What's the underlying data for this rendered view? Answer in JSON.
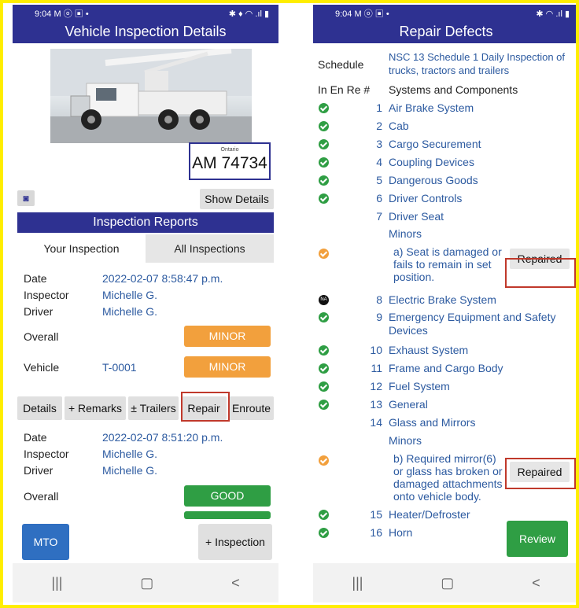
{
  "left": {
    "status_time": "9:04",
    "status_left_icons": "M ⓞ ▣ •",
    "status_right_icons": "✱ ♦ ◠ .ıl ▮",
    "title": "Vehicle Inspection Details",
    "plate_province": "Ontario",
    "plate_number": "AM 74734",
    "show_details": "Show Details",
    "section_title": "Inspection Reports",
    "tabs": [
      "Your Inspection",
      "All Inspections"
    ],
    "report1": {
      "date_label": "Date",
      "date": "2022-02-07 8:58:47 p.m.",
      "inspector_label": "Inspector",
      "inspector": "Michelle G.",
      "driver_label": "Driver",
      "driver": "Michelle G.",
      "overall_label": "Overall",
      "overall": "MINOR",
      "vehicle_label": "Vehicle",
      "vehicle": "T-0001",
      "vehicle_status": "MINOR"
    },
    "actions": [
      "Details",
      "+ Remarks",
      "± Trailers",
      "Repair",
      "Enroute"
    ],
    "report2": {
      "date_label": "Date",
      "date": "2022-02-07 8:51:20 p.m.",
      "inspector_label": "Inspector",
      "inspector": "Michelle G.",
      "driver_label": "Driver",
      "driver": "Michelle G.",
      "overall_label": "Overall",
      "overall": "GOOD"
    },
    "mto": "MTO",
    "add_inspection": "+ Inspection"
  },
  "right": {
    "status_time": "9:04",
    "status_left_icons": "M ⓞ ▣ •",
    "status_right_icons": "✱ ◠ .ıl ▮",
    "title": "Repair Defects",
    "schedule_label": "Schedule",
    "schedule_value": "NSC 13 Schedule 1 Daily Inspection of trucks, tractors and trailers",
    "col_headers": "In  En  Re #",
    "col_systems": "Systems and Components",
    "items": [
      {
        "num": "1",
        "name": "Air Brake System"
      },
      {
        "num": "2",
        "name": "Cab"
      },
      {
        "num": "3",
        "name": "Cargo Securement"
      },
      {
        "num": "4",
        "name": "Coupling Devices"
      },
      {
        "num": "5",
        "name": "Dangerous Goods"
      },
      {
        "num": "6",
        "name": "Driver Controls"
      },
      {
        "num": "7",
        "name": "Driver Seat"
      },
      {
        "num": "8",
        "name": "Electric Brake System"
      },
      {
        "num": "9",
        "name": "Emergency Equipment and Safety Devices"
      },
      {
        "num": "10",
        "name": "Exhaust System"
      },
      {
        "num": "11",
        "name": "Frame and Cargo Body"
      },
      {
        "num": "12",
        "name": "Fuel System"
      },
      {
        "num": "13",
        "name": "General"
      },
      {
        "num": "14",
        "name": "Glass and Mirrors"
      },
      {
        "num": "15",
        "name": "Heater/Defroster"
      },
      {
        "num": "16",
        "name": "Horn"
      }
    ],
    "minors_label": "Minors",
    "defect_a": "a) Seat is damaged or fails to remain in set position.",
    "defect_b": "b) Required mirror(6) or glass has broken or damaged attachments onto vehicle body.",
    "repaired": "Repaired",
    "na_badge": "NA",
    "review": "Review"
  },
  "nav": {
    "recent": "|||",
    "home": "▢",
    "back": "<"
  },
  "colors": {
    "header": "#2e3191",
    "minor": "#f2a03d",
    "good": "#2f9e44",
    "link": "#2c5aa0",
    "highlight": "#c0392b",
    "frame": "#ffee00"
  }
}
